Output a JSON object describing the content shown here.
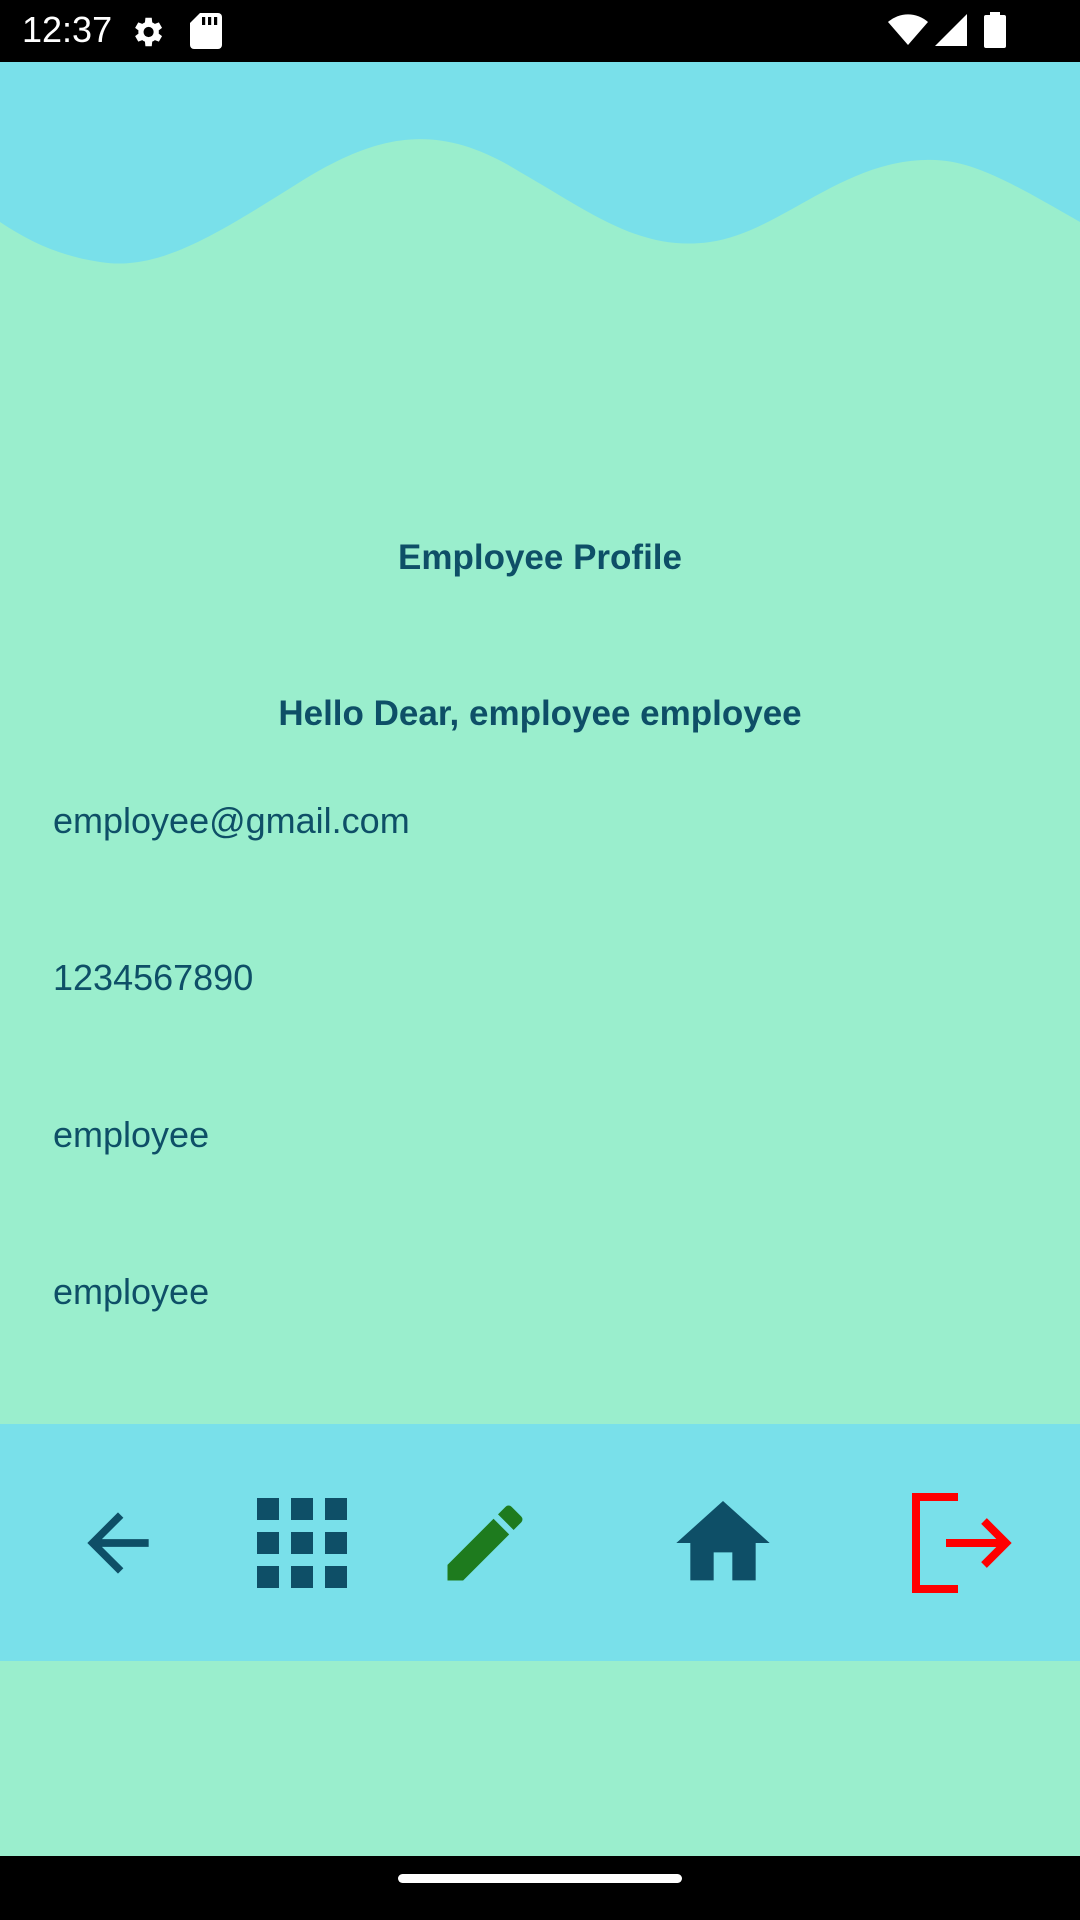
{
  "status_bar": {
    "time": "12:37",
    "icons": [
      "gear-icon",
      "sd-card-icon",
      "wifi-icon",
      "signal-icon",
      "battery-icon"
    ]
  },
  "page": {
    "title": "Employee Profile",
    "greeting": "Hello Dear, employee employee"
  },
  "profile": {
    "email": "employee@gmail.com",
    "phone": "1234567890",
    "first_name": "employee",
    "last_name": "employee"
  },
  "bottom_nav": {
    "items": [
      {
        "icon": "back-arrow-icon",
        "color": "#0E4F67"
      },
      {
        "icon": "grid-icon",
        "color": "#0E4F67"
      },
      {
        "icon": "pencil-icon",
        "color": "#1E7B1E"
      },
      {
        "icon": "home-icon",
        "color": "#0E4F67"
      },
      {
        "icon": "logout-icon",
        "color": "#FF0000"
      }
    ]
  },
  "colors": {
    "background": "#9AEECD",
    "wave": "#79E0EA",
    "text": "#0E4F67",
    "nav_background": "#79E0EA",
    "edit": "#1E7B1E",
    "logout": "#FF0000"
  }
}
